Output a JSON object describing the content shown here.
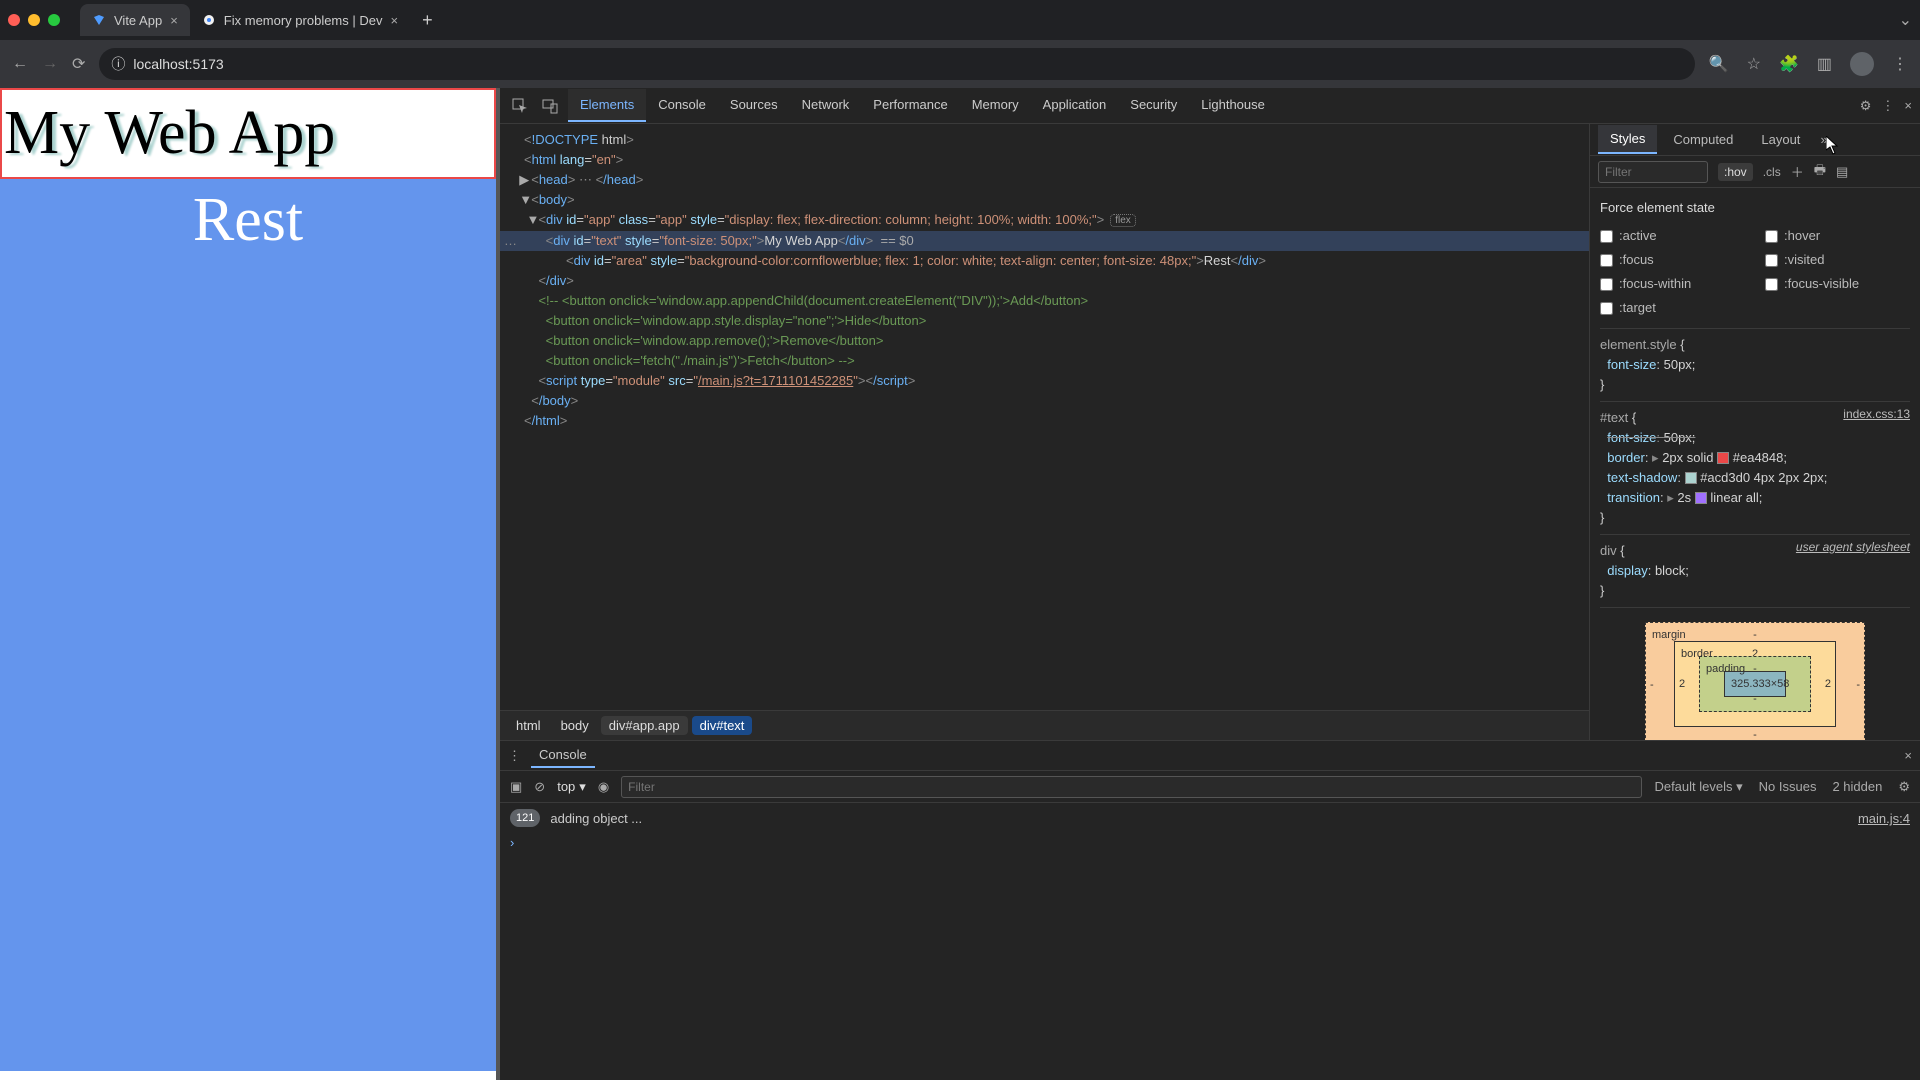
{
  "window": {
    "tabs": [
      {
        "title": "Vite App",
        "active": true,
        "favicon": "triangle"
      },
      {
        "title": "Fix memory problems | Dev",
        "active": false,
        "favicon": "chrome"
      }
    ]
  },
  "address": {
    "url": "localhost:5173",
    "scheme_icon": "info"
  },
  "page": {
    "heading_text": "My Web App",
    "area_text": "Rest"
  },
  "devtools": {
    "tabs": [
      "Elements",
      "Console",
      "Sources",
      "Network",
      "Performance",
      "Memory",
      "Application",
      "Security",
      "Lighthouse"
    ],
    "active_tab": "Elements",
    "dom": {
      "lines": [
        {
          "indent": 0,
          "html": "<!DOCTYPE html>"
        },
        {
          "indent": 0,
          "html": "<html lang=\"en\">"
        },
        {
          "indent": 1,
          "caret": "▶",
          "html": "<head>…</head>",
          "ellipsis_badge": true
        },
        {
          "indent": 1,
          "caret": "▼",
          "html": "<body>"
        },
        {
          "indent": 2,
          "caret": "▼",
          "html": "<div id=\"app\" class=\"app\" style=\"display: flex; flex-direction: column; height: 100%; width: 100%;\">",
          "flex_badge": "flex"
        },
        {
          "indent": 3,
          "selected": true,
          "gutter": "…",
          "html": "<div id=\"text\" style=\"font-size: 50px;\">My Web App</div>",
          "dollar0": " == $0"
        },
        {
          "indent": 3,
          "html": "<div id=\"area\" style=\"background-color:cornflowerblue; flex: 1; color: white; text-align: center; font-size: 48px;\">Rest</div>",
          "wrap": true
        },
        {
          "indent": 2,
          "html": "</div>",
          "close_only": true
        },
        {
          "indent": 2,
          "comment": "<!-- <button onclick='window.app.appendChild(document.createElement(\"DIV\"));'>Add</button>"
        },
        {
          "indent": 3,
          "comment": "<button onclick='window.app.style.display=\"none\";'>Hide</button>"
        },
        {
          "indent": 3,
          "comment": "<button onclick='window.app.remove();'>Remove</button>"
        },
        {
          "indent": 3,
          "comment": "<button onclick='fetch(\"./main.js\")'>Fetch</button> -->"
        },
        {
          "indent": 2,
          "html": "<script type=\"module\" src=\"/main.js?t=1711101452285\"></script>",
          "src_underline": "/main.js?t=1711101452285"
        },
        {
          "indent": 1,
          "html": "</body>"
        },
        {
          "indent": 0,
          "html": "</html>"
        }
      ]
    },
    "breadcrumb": [
      "html",
      "body",
      "div#app.app",
      "div#text"
    ],
    "styles_tabs": [
      "Styles",
      "Computed",
      "Layout"
    ],
    "styles_active": "Styles",
    "filter_placeholder": "Filter",
    "toolbar_hov": ":hov",
    "toolbar_cls": ".cls",
    "force_label": "Force element state",
    "states": [
      ":active",
      ":hover",
      ":focus",
      ":visited",
      ":focus-within",
      ":focus-visible",
      ":target"
    ],
    "rules": [
      {
        "selector": "element.style",
        "props": [
          {
            "name": "font-size",
            "value": "50px;",
            "strike": false
          }
        ]
      },
      {
        "selector": "#text",
        "origin": "index.css:13",
        "props": [
          {
            "name": "font-size",
            "value": "50px;",
            "strike": true
          },
          {
            "name": "border",
            "value": "2px solid",
            "swatch": "#ea4848",
            "value_after": "#ea4848;",
            "expander": "▸"
          },
          {
            "name": "text-shadow",
            "value": "",
            "swatch": "#acd3d0",
            "value_after": "#acd3d0 4px 2px 2px;"
          },
          {
            "name": "transition",
            "value": "2s",
            "timing_swatch": true,
            "value_after": "linear all;",
            "expander": "▸"
          }
        ]
      },
      {
        "selector": "div",
        "ua": "user agent stylesheet",
        "props": [
          {
            "name": "display",
            "value": "block;"
          }
        ]
      }
    ],
    "box_model": {
      "margin": {
        "t": "-",
        "r": "-",
        "b": "-",
        "l": "-"
      },
      "border": {
        "t": "2",
        "r": "2",
        "b": "",
        "l": "2"
      },
      "padding": {
        "t": "-",
        "r": "-",
        "b": "-",
        "l": "-"
      },
      "content": "325.333×58"
    }
  },
  "console": {
    "tab_label": "Console",
    "top_label": "top",
    "filter_placeholder": "Filter",
    "levels_label": "Default levels",
    "issues_label": "No Issues",
    "hidden_label": "2 hidden",
    "log": {
      "count": "121",
      "msg": "adding object ...",
      "src": "main.js:4"
    }
  }
}
